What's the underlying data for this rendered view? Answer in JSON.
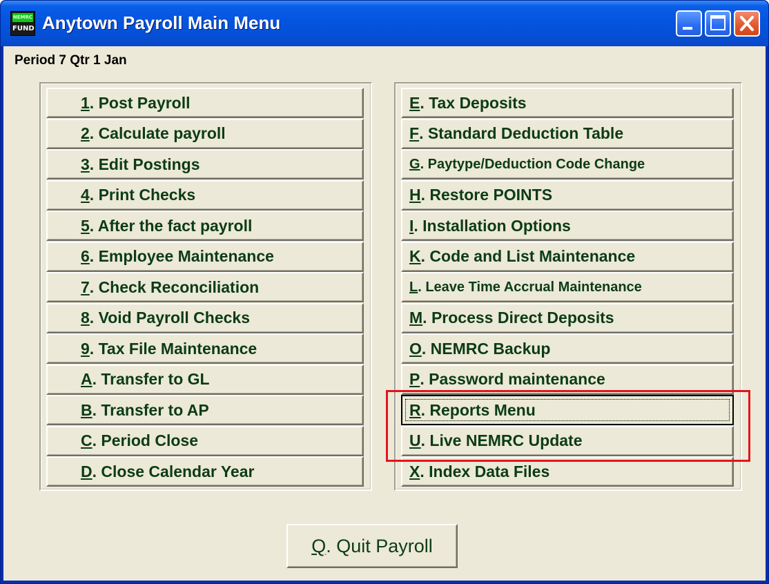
{
  "window": {
    "title": "Anytown Payroll  Main Menu"
  },
  "app_icon": {
    "top_text": "NEMRC",
    "bottom_text": "FUND"
  },
  "titlebar_buttons": {
    "minimize": "minimize-icon",
    "maximize": "maximize-icon",
    "close": "close-icon"
  },
  "period_label": "Period 7 Qtr 1 Jan",
  "left_menu": [
    {
      "key": "1",
      "label": ". Post Payroll"
    },
    {
      "key": "2",
      "label": ". Calculate payroll"
    },
    {
      "key": "3",
      "label": ". Edit Postings"
    },
    {
      "key": "4",
      "label": ". Print Checks"
    },
    {
      "key": "5",
      "label": ". After the fact payroll"
    },
    {
      "key": "6",
      "label": ". Employee Maintenance"
    },
    {
      "key": "7",
      "label": ". Check Reconciliation"
    },
    {
      "key": "8",
      "label": ". Void Payroll Checks"
    },
    {
      "key": "9",
      "label": ". Tax File Maintenance"
    },
    {
      "key": "A",
      "label": ". Transfer to GL"
    },
    {
      "key": "B",
      "label": ". Transfer to AP"
    },
    {
      "key": "C",
      "label": ". Period Close"
    },
    {
      "key": "D",
      "label": ". Close Calendar Year"
    }
  ],
  "right_menu": [
    {
      "key": "E",
      "label": ". Tax Deposits"
    },
    {
      "key": "F",
      "label": ". Standard Deduction Table"
    },
    {
      "key": "G",
      "label": ". Paytype/Deduction Code Change"
    },
    {
      "key": "H",
      "label": ".  Restore POINTS"
    },
    {
      "key": "I",
      "label": ".  Installation Options"
    },
    {
      "key": "K",
      "label": ". Code and List Maintenance"
    },
    {
      "key": "L",
      "label": ". Leave Time Accrual Maintenance"
    },
    {
      "key": "M",
      "label": ". Process Direct Deposits"
    },
    {
      "key": "O",
      "label": ". NEMRC Backup"
    },
    {
      "key": "P",
      "label": ".  Password maintenance"
    },
    {
      "key": "R",
      "label": ".  Reports Menu"
    },
    {
      "key": "U",
      "label": ". Live NEMRC Update"
    },
    {
      "key": "X",
      "label": ".  Index Data Files"
    }
  ],
  "quit_button": {
    "key": "Q",
    "label": ". Quit Payroll"
  },
  "colors": {
    "highlight": "#e4141e",
    "button_text": "#0c3b17",
    "titlebar": "#0555e0"
  }
}
